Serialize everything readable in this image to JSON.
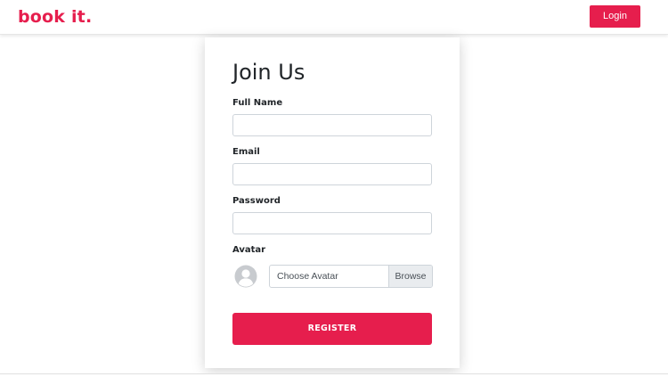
{
  "navbar": {
    "brand": "book it.",
    "login_label": "Login"
  },
  "form": {
    "title": "Join Us",
    "full_name": {
      "label": "Full Name",
      "value": "",
      "placeholder": ""
    },
    "email": {
      "label": "Email",
      "value": "",
      "placeholder": ""
    },
    "password": {
      "label": "Password",
      "value": "",
      "placeholder": ""
    },
    "avatar": {
      "label": "Avatar",
      "icon": "user-circle-icon",
      "file_placeholder": "Choose Avatar",
      "browse_label": "Browse"
    },
    "register_label": "REGISTER"
  },
  "colors": {
    "brand": "#e61e4d",
    "text": "#212529",
    "input_border": "#ced4da",
    "avatar_icon": "#c8cbcf"
  }
}
